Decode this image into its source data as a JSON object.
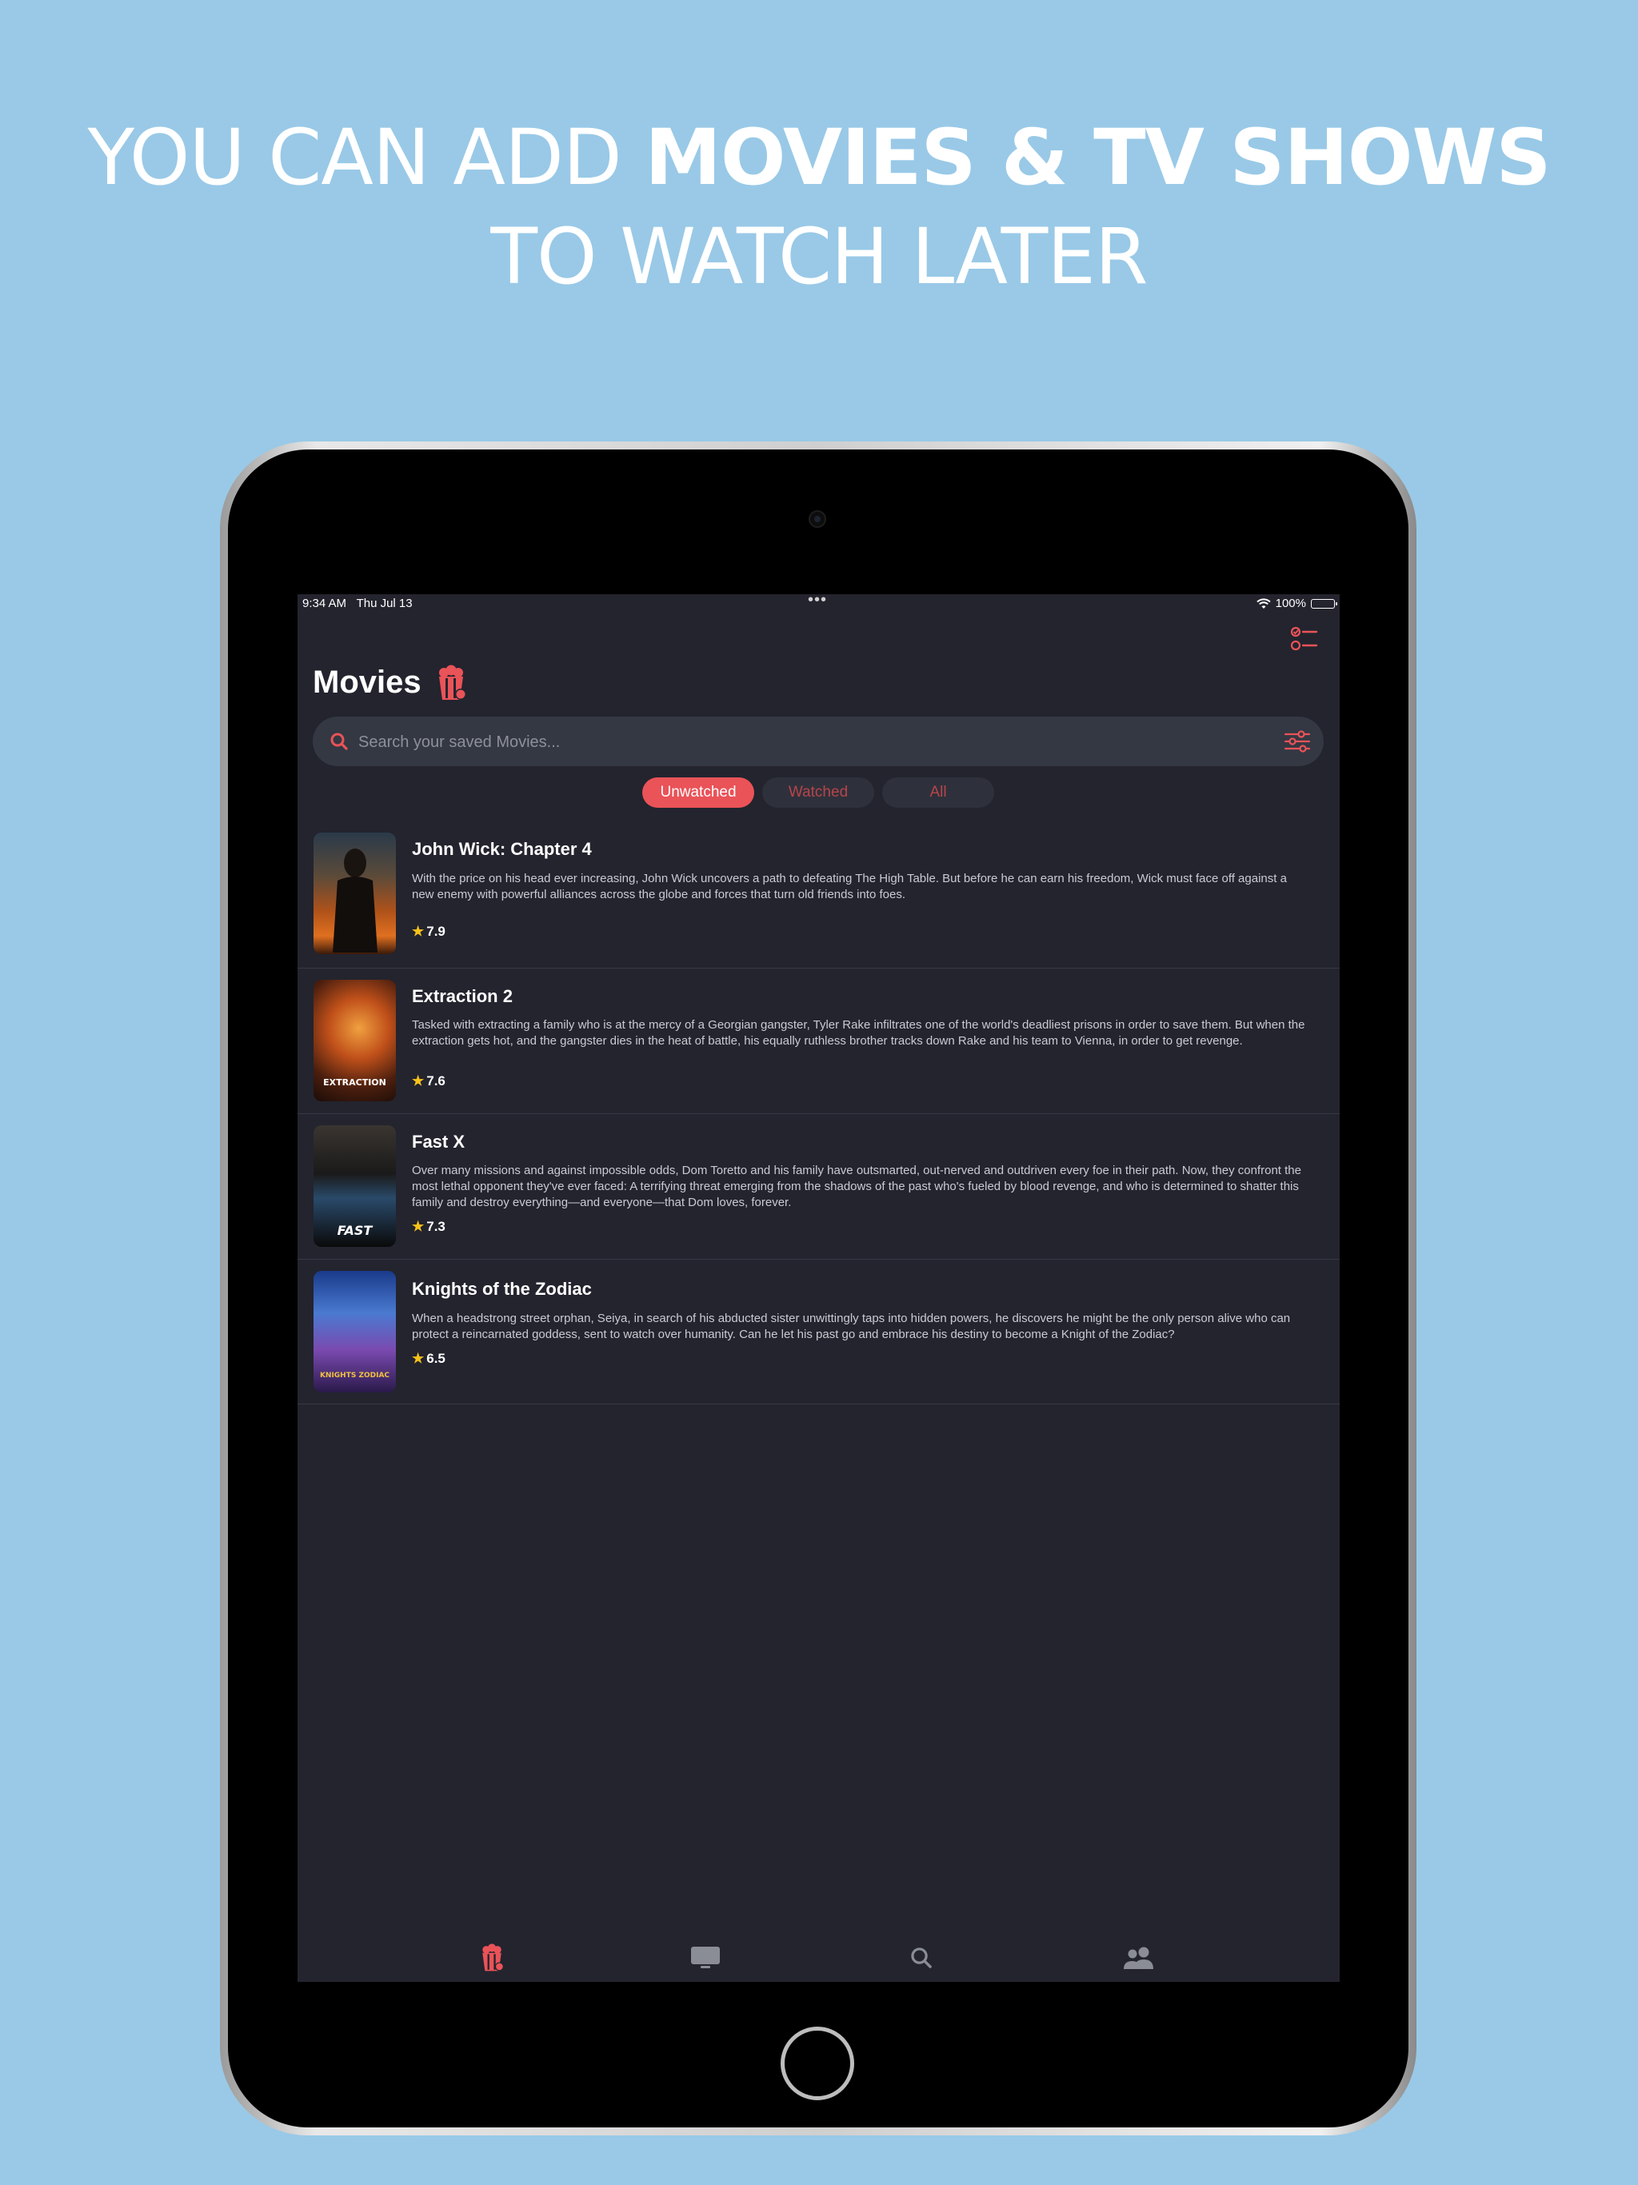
{
  "headline": {
    "line1_regular": "YOU CAN ADD ",
    "line1_bold": "MOVIES & TV SHOWS",
    "line2": "TO WATCH LATER"
  },
  "status_bar": {
    "time": "9:34 AM",
    "date": "Thu Jul 13",
    "dots": "•••",
    "battery": "100%",
    "battery_level": 1.0
  },
  "header": {
    "title": "Movies",
    "title_icon": "popcorn-icon",
    "toggle_icon": "checklist-icon"
  },
  "search": {
    "placeholder": "Search your saved Movies...",
    "value": "",
    "icon": "search-icon",
    "filter_icon": "sliders-icon"
  },
  "segments": [
    {
      "label": "Unwatched",
      "active": true
    },
    {
      "label": "Watched",
      "active": false
    },
    {
      "label": "All",
      "active": false
    }
  ],
  "movies": [
    {
      "title": "John Wick: Chapter 4",
      "overview": "With the price on his head ever increasing, John Wick uncovers a path to defeating The High Table. But before he can earn his freedom, Wick must face off against a new enemy with powerful alliances across the globe and forces that turn old friends into foes.",
      "rating": "7.9"
    },
    {
      "title": "Extraction 2",
      "overview": "Tasked with extracting a family who is at the mercy of a Georgian gangster, Tyler Rake infiltrates one of the world's deadliest prisons in order to save them. But when the extraction gets hot, and the gangster dies in the heat of battle, his equally ruthless brother tracks down Rake and his team to Vienna, in order to get revenge.",
      "rating": "7.6",
      "poster_text": "EXTRACTION"
    },
    {
      "title": "Fast X",
      "overview": "Over many missions and against impossible odds, Dom Toretto and his family have outsmarted, out-nerved and outdriven every foe in their path. Now, they confront the most lethal opponent they've ever faced: A terrifying threat emerging from the shadows of the past who's fueled by blood revenge, and who is determined to shatter this family and destroy everything—and everyone—that Dom loves, forever.",
      "rating": "7.3",
      "poster_text": "FAST"
    },
    {
      "title": "Knights of the Zodiac",
      "overview": "When a headstrong street orphan, Seiya, in search of his abducted sister unwittingly taps into hidden powers, he discovers he might be the only person alive who can protect a reincarnated goddess, sent to watch over humanity. Can he let his past go and embrace his destiny to become a Knight of the Zodiac?",
      "rating": "6.5",
      "poster_text": "KNIGHTS ZODIAC"
    }
  ],
  "tab_bar": [
    {
      "icon": "popcorn-icon",
      "active": true
    },
    {
      "icon": "tv-icon",
      "active": false
    },
    {
      "icon": "search-icon",
      "active": false
    },
    {
      "icon": "people-icon",
      "active": false
    }
  ],
  "colors": {
    "background": "#99c9e7",
    "screen": "#23242e",
    "accent": "#ea5358",
    "star": "#f7c21a"
  }
}
